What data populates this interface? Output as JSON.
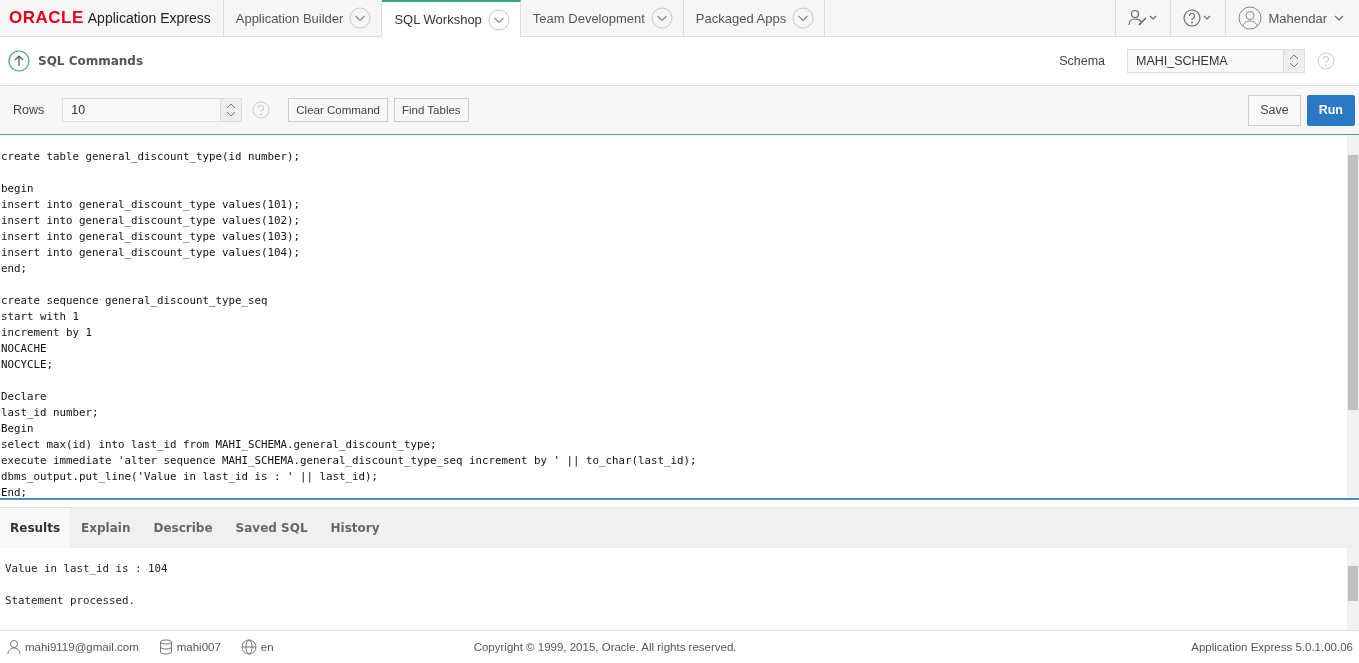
{
  "logo": {
    "brand": "ORACLE",
    "product": "Application Express"
  },
  "nav_tabs": [
    {
      "label": "Application Builder",
      "selected": false
    },
    {
      "label": "SQL Workshop",
      "selected": true
    },
    {
      "label": "Team Development",
      "selected": false
    },
    {
      "label": "Packaged Apps",
      "selected": false
    }
  ],
  "user": {
    "name": "Mahendar"
  },
  "page": {
    "title": "SQL Commands",
    "schema_label": "Schema",
    "schema_value": "MAHI_SCHEMA"
  },
  "toolbar": {
    "rows_label": "Rows",
    "rows_value": "10",
    "buttons": [
      "Clear Command",
      "Find Tables"
    ],
    "save": "Save",
    "run": "Run"
  },
  "editor": {
    "code": "create table general_discount_type(id number);\n\nbegin\ninsert into general_discount_type values(101);\ninsert into general_discount_type values(102);\ninsert into general_discount_type values(103);\ninsert into general_discount_type values(104);\nend;\n\ncreate sequence general_discount_type_seq\nstart with 1\nincrement by 1\nNOCACHE\nNOCYCLE;\n\nDeclare\nlast_id number;\nBegin\nselect max(id) into last_id from MAHI_SCHEMA.general_discount_type;\nexecute immediate 'alter sequence MAHI_SCHEMA.general_discount_type_seq increment by ' || to_char(last_id);\ndbms_output.put_line('Value in last_id is : ' || last_id);\nEnd;"
  },
  "result_tabs": [
    {
      "label": "Results",
      "selected": true
    },
    {
      "label": "Explain",
      "selected": false
    },
    {
      "label": "Describe",
      "selected": false
    },
    {
      "label": "Saved SQL",
      "selected": false
    },
    {
      "label": "History",
      "selected": false
    }
  ],
  "results": {
    "output": "Value in last_id is : 104\n\nStatement processed."
  },
  "footer": {
    "email": "mahi9119@gmail.com",
    "workspace": "mahi007",
    "language": "en",
    "copyright": "Copyright © 1999, 2015, Oracle. All rights reserved.",
    "version": "Application Express 5.0.1.00.06"
  }
}
